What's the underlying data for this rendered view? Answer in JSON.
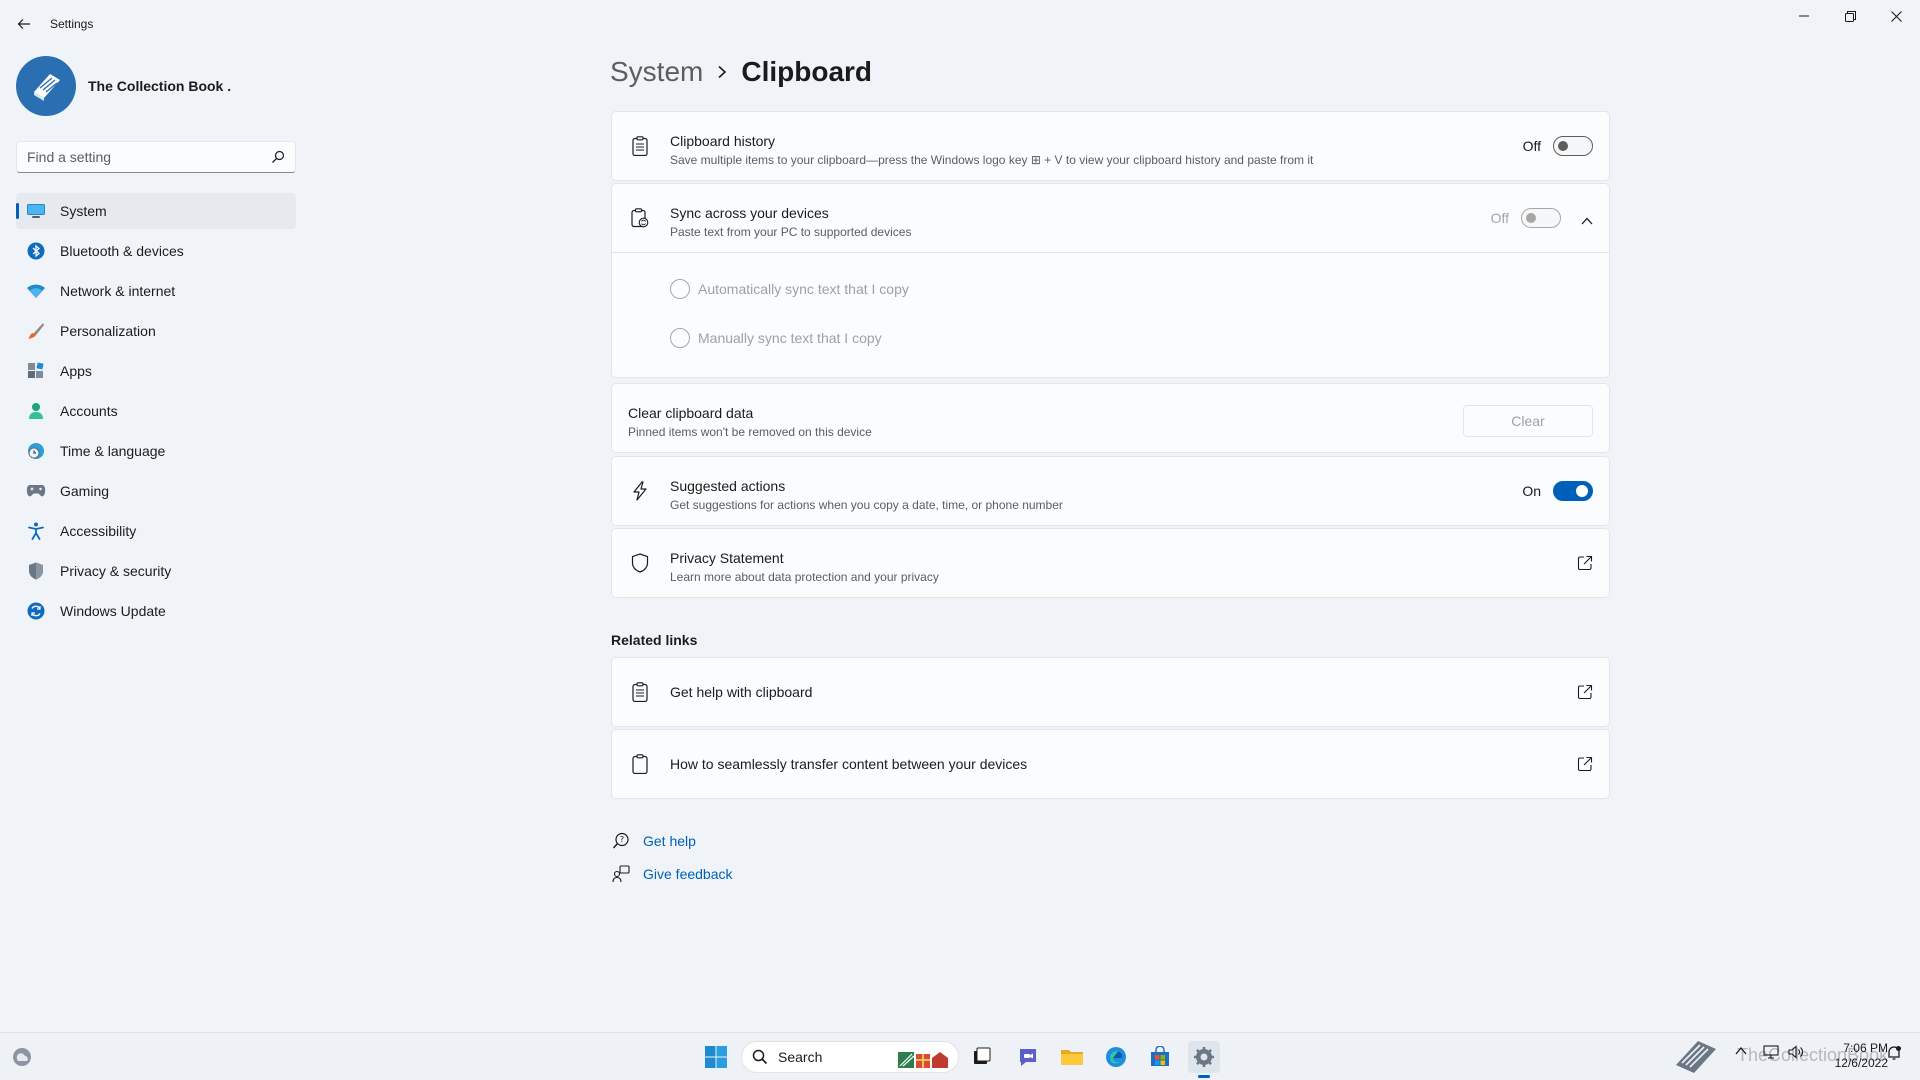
{
  "window": {
    "title": "Settings",
    "back_icon": "back-arrow-icon",
    "min_icon": "minimize-icon",
    "max_icon": "restore-icon",
    "close_icon": "close-icon"
  },
  "profile": {
    "name": "The Collection Book ."
  },
  "search": {
    "placeholder": "Find a setting"
  },
  "sidebar": {
    "items": [
      {
        "label": "System",
        "icon": "system-icon",
        "active": true
      },
      {
        "label": "Bluetooth & devices",
        "icon": "bluetooth-icon"
      },
      {
        "label": "Network & internet",
        "icon": "wifi-icon"
      },
      {
        "label": "Personalization",
        "icon": "brush-icon"
      },
      {
        "label": "Apps",
        "icon": "apps-icon"
      },
      {
        "label": "Accounts",
        "icon": "account-icon"
      },
      {
        "label": "Time & language",
        "icon": "globe-clock-icon"
      },
      {
        "label": "Gaming",
        "icon": "gamepad-icon"
      },
      {
        "label": "Accessibility",
        "icon": "accessibility-icon"
      },
      {
        "label": "Privacy & security",
        "icon": "shield-icon"
      },
      {
        "label": "Windows Update",
        "icon": "update-icon"
      }
    ]
  },
  "breadcrumb": {
    "parent": "System",
    "current": "Clipboard"
  },
  "settings": {
    "clipboard_history": {
      "title": "Clipboard history",
      "desc": "Save multiple items to your clipboard—press the Windows logo key ⊞ + V to view your clipboard history and paste from it",
      "state_label": "Off",
      "on": false
    },
    "sync": {
      "title": "Sync across your devices",
      "desc": "Paste text from your PC to supported devices",
      "state_label": "Off",
      "on": false,
      "options": [
        "Automatically sync text that I copy",
        "Manually sync text that I copy"
      ]
    },
    "clear": {
      "title": "Clear clipboard data",
      "desc": "Pinned items won't be removed on this device",
      "button": "Clear"
    },
    "suggested": {
      "title": "Suggested actions",
      "desc": "Get suggestions for actions when you copy a date, time, or phone number",
      "state_label": "On",
      "on": true
    },
    "privacy": {
      "title": "Privacy Statement",
      "desc": "Learn more about data protection and your privacy"
    }
  },
  "related": {
    "title": "Related links",
    "links": [
      "Get help with clipboard",
      "How to seamlessly transfer content between your devices"
    ]
  },
  "help": {
    "get_help": "Get help",
    "feedback": "Give feedback"
  },
  "taskbar": {
    "search_label": "Search",
    "time": "7:06 PM",
    "date": "12/6/2022",
    "watermark": "TheCollectionBook"
  },
  "colors": {
    "accent": "#005fb8",
    "background": "#f0f4f9",
    "card": "#fbfcfe"
  }
}
